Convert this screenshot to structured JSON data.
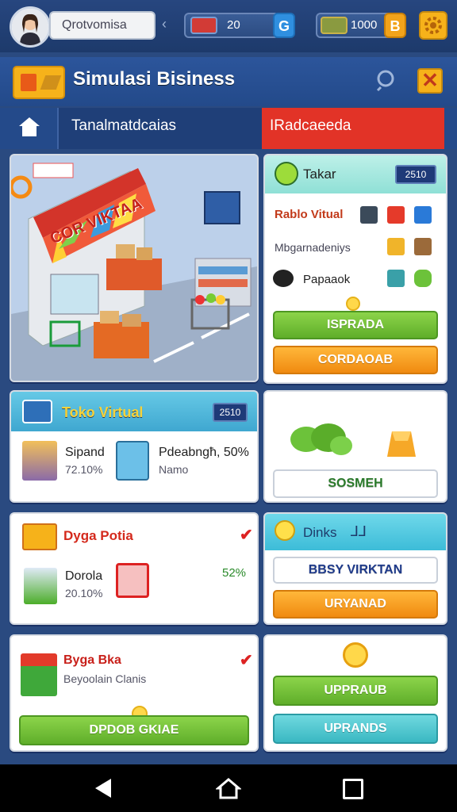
{
  "topbar": {
    "player_name": "Qrotvomisa",
    "res1_value": "20",
    "res1_btn": "G",
    "res2_value": "1000",
    "res2_btn": "B"
  },
  "header": {
    "title": "Simulasi Bisiness"
  },
  "tabs": {
    "tab1": "Tanalmatdcaias",
    "tab2": "IRadcaeeda"
  },
  "card_top_right": {
    "title": "Takar",
    "badge": "2510",
    "row1": "Rablo Vitual",
    "row2": "Mbgarnadeniys",
    "row3": "Papaaok",
    "btn1": "ISPRADA",
    "btn2": "CORDAOAB"
  },
  "store_scene": {
    "sign": "COR VIKTAA"
  },
  "card_toko": {
    "title": "Toko Virtual",
    "badge": "2510",
    "item1_name": "Sipand",
    "item1_value": "72.10%",
    "item2_name": "Pdeabngħ, 50%",
    "item2_sub": "Namo"
  },
  "card_mid_right": {
    "btn": "SOSMEH"
  },
  "card_dyga": {
    "title": "Dyga Potia",
    "item_name": "Dorola",
    "item_value": "20.10%",
    "percent": "52%"
  },
  "card_dinks": {
    "title": "Dinks",
    "btn1": "BBSY VIRKTAN",
    "btn2": "URYANAD"
  },
  "card_byga": {
    "title": "Byga Bka",
    "subtitle": "Beyoolain Clanis",
    "btn": "DPDOB GKIAE"
  },
  "card_bottom_right": {
    "btn1": "UPPRAUB",
    "btn2": "UPRANDS"
  },
  "colors": {
    "accent_orange": "#f6b21a",
    "red_tab": "#e23327",
    "green_btn": "#6fc236",
    "teal_btn": "#3ab8c2"
  },
  "icons": [
    "avatar",
    "wallet-icon",
    "coins-icon",
    "gear-icon",
    "search-icon",
    "close-icon",
    "home-icon",
    "nav-back-icon",
    "nav-home-icon",
    "nav-recent-icon"
  ]
}
